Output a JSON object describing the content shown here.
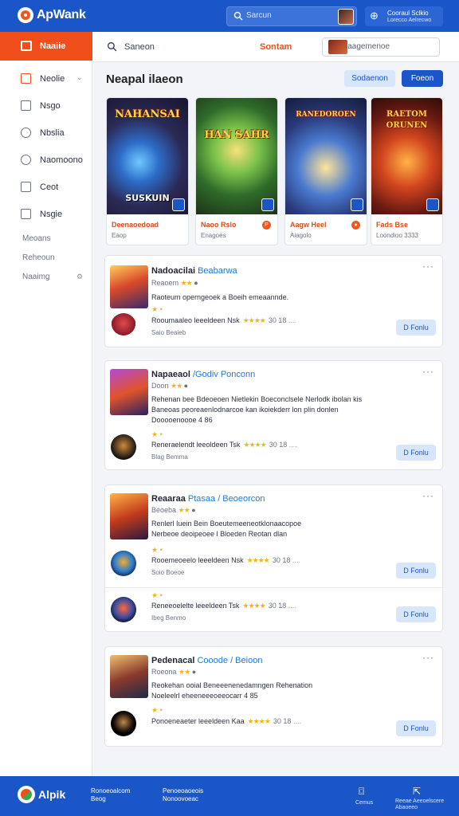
{
  "header": {
    "app_name": "ApWank",
    "search_placeholder": "Sarcun",
    "account": {
      "line1": "Cooraul Sclkio",
      "line2": "Lorecco Aelrecwo"
    }
  },
  "sidebar": {
    "active": "Naaiie",
    "items": [
      {
        "label": "Neolie"
      },
      {
        "label": "Nsgo"
      },
      {
        "label": "Nbslia"
      },
      {
        "label": "Naomoono"
      },
      {
        "label": "Ceot"
      },
      {
        "label": "Nsgie"
      }
    ],
    "sub_items": [
      "Meoans",
      "Reheoun",
      "Naaimg"
    ]
  },
  "main_header": {
    "search_label": "Saneon",
    "link": "Sontam",
    "search_field": "Naagemenoe"
  },
  "section": {
    "title": "Neapal ilaeon",
    "btn_secondary": "Sodaenon",
    "btn_primary": "Foeon"
  },
  "featured": [
    {
      "art_title": "NAHANSAI",
      "art_sub": "SUSKUIN",
      "name": "Deenaoedoad",
      "meta": "Eaop"
    },
    {
      "art_title": "HAN SAHR",
      "art_sub": "",
      "name": "Naoo Rslo",
      "meta": "Enagoes"
    },
    {
      "art_title": "RANEDOROEN",
      "art_sub": "",
      "name": "Aagw Heel",
      "meta": "Aiagolo"
    },
    {
      "art_title": "RAETOM ORUNEN",
      "art_sub": "",
      "name": "Fads Bse",
      "meta": "Loondioo 3333"
    }
  ],
  "list": [
    {
      "title": "Nadoacilai",
      "title_suffix": "Beabarwa",
      "sub": "Reaoem",
      "desc": [
        "Raoteum operngeoek a Boeih emeaannde."
      ],
      "entries": [
        {
          "dev": "Rooumaaleo leeeldeen Nsk",
          "score": "30 18",
          "dev_sub": "Saio Beaieb",
          "btn": "D Fonlu"
        }
      ]
    },
    {
      "title": "Napaeaol",
      "title_suffix": "/Godiv Ponconn",
      "sub": "Doon",
      "desc": [
        "Rehenan bee Bdeoeoen Nietlekin Boeconclsele Nerlodk ibolan kis",
        "Baneoas peoreaenlodnarcoe kan ikoiekderr lon plin donlen",
        "Dooooenoooe 4 86"
      ],
      "entries": [
        {
          "dev": "Reneraelendt leeoldeen Tsk",
          "score": "30 18",
          "dev_sub": "Blag Bemma",
          "btn": "D Fonlu"
        }
      ]
    },
    {
      "title": "Reaaraa",
      "title_suffix": "Ptasaa / Beoeorcon",
      "sub": "Beoeba",
      "desc": [
        "Renlerl Iuein Bein Boeutemeeneotklonaacopoe",
        "Nerbeoe deoipeoee l Bloeden Reotan dlan"
      ],
      "entries": [
        {
          "dev": "Rooemeoeelo leeeldeen Nsk",
          "score": "30 18",
          "dev_sub": "Soio Boeoe",
          "btn": "D Fonlu"
        },
        {
          "dev": "Reneeoelelte leeeldeen Tsk",
          "score": "30 18",
          "dev_sub": "Ibeg Benmo",
          "btn": "D Fonlu"
        }
      ]
    },
    {
      "title": "Pedenacal",
      "title_suffix": "Cooode / Beioon",
      "sub": "Roeona",
      "desc": [
        "Reokehan ooial Beneeenenedamngen Rehenation",
        "Noeleelrl eheeneeeoeeocarr 4 85"
      ],
      "entries": [
        {
          "dev": "Ponoeneaeter leeeldeen Kaa",
          "score": "30 18",
          "dev_sub": "",
          "btn": "D Fonlu"
        }
      ]
    }
  ],
  "footer": {
    "app_name": "Alpik",
    "col1": [
      "Ronoeoalcom",
      "Beog"
    ],
    "col2": [
      "Penoeoaoeois",
      "Nonoovoeac"
    ],
    "icon1_label": "Cemus",
    "icon2_label": [
      "Reeae Aeeoelscere",
      "Abaoeeo"
    ]
  },
  "colors": {
    "brand_blue": "#1b56c8",
    "accent_orange": "#f04e1b",
    "star": "#f3b41b"
  }
}
